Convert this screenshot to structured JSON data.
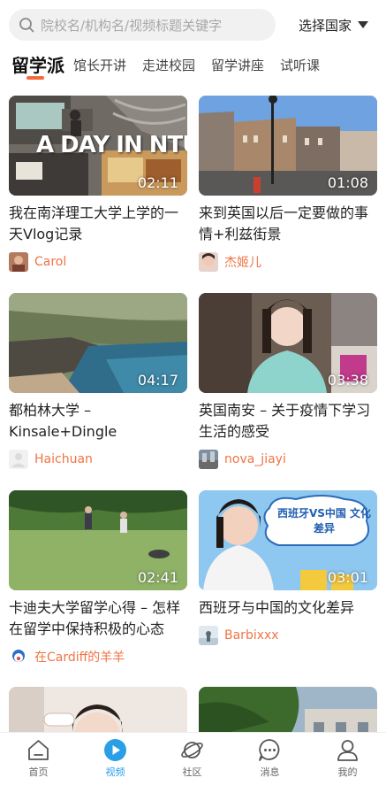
{
  "search": {
    "placeholder": "院校名/机构名/视频标题关键字"
  },
  "country_select": {
    "label": "选择国家"
  },
  "tabs": [
    {
      "label": "留学派",
      "active": true
    },
    {
      "label": "馆长开讲",
      "active": false
    },
    {
      "label": "走进校园",
      "active": false
    },
    {
      "label": "留学讲座",
      "active": false
    },
    {
      "label": "试听课",
      "active": false
    }
  ],
  "accent_color": "#f26a3b",
  "author_color": "#ef7445",
  "nav_active_color": "#2a9fe6",
  "cards": [
    {
      "thumb_text": "A DAY IN NTU",
      "duration": "02:11",
      "title": "我在南洋理工大学上学的一天Vlog记录",
      "author": "Carol"
    },
    {
      "thumb_text": "",
      "duration": "01:08",
      "title": "来到英国以后一定要做的事情+利兹街景",
      "author": "杰姬儿"
    },
    {
      "thumb_text": "",
      "duration": "04:17",
      "title": "都柏林大学 – Kinsale+Dingle",
      "author": "Haichuan"
    },
    {
      "thumb_text": "",
      "duration": "03:38",
      "title": "英国南安 – 关于疫情下学习生活的感受",
      "author": "nova_jiayi"
    },
    {
      "thumb_text": "",
      "duration": "02:41",
      "title": "卡迪夫大学留学心得 – 怎样在留学中保持积极的心态",
      "author": "在Cardiff的羊羊"
    },
    {
      "thumb_text": "西班牙VS中国 文化差异",
      "duration": "03:01",
      "title": "西班牙与中国的文化差异",
      "author": "Barbixxx"
    },
    {
      "thumb_text": "",
      "duration": "",
      "title": "",
      "author": ""
    },
    {
      "thumb_text": "",
      "duration": "",
      "title": "",
      "author": ""
    }
  ],
  "bottom_nav": [
    {
      "label": "首页",
      "icon": "home-icon",
      "active": false
    },
    {
      "label": "视频",
      "icon": "video-play-icon",
      "active": true
    },
    {
      "label": "社区",
      "icon": "planet-icon",
      "active": false
    },
    {
      "label": "消息",
      "icon": "chat-bubble-icon",
      "active": false
    },
    {
      "label": "我的",
      "icon": "profile-icon",
      "active": false
    }
  ]
}
